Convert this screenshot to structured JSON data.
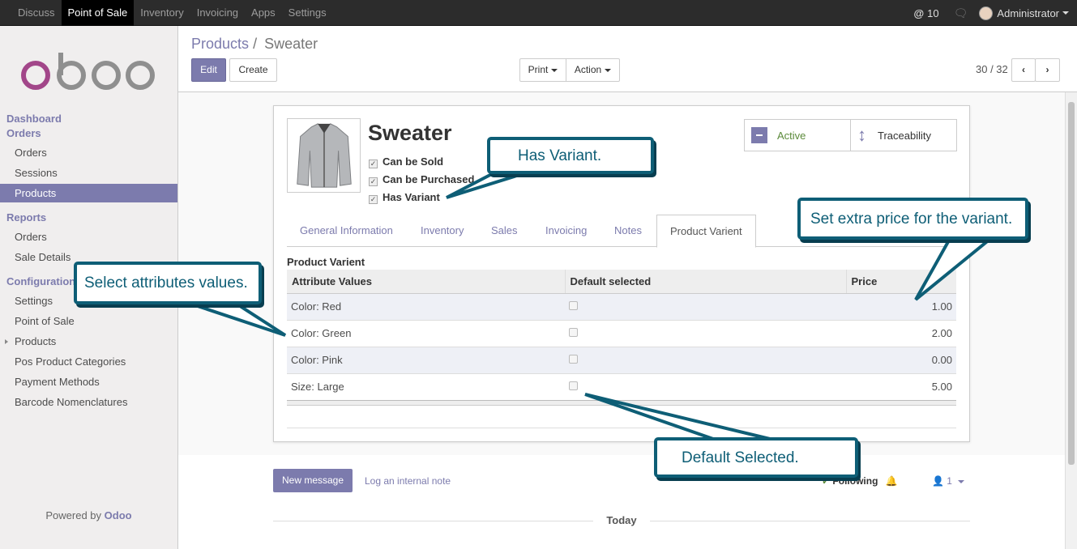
{
  "topbar": {
    "menu": [
      "Discuss",
      "Point of Sale",
      "Inventory",
      "Invoicing",
      "Apps",
      "Settings"
    ],
    "active_menu": "Point of Sale",
    "mentions_symbol": "@",
    "mentions_count": "10",
    "user": "Administrator"
  },
  "sidebar": {
    "dashboard": "Dashboard",
    "orders_section": "Orders",
    "orders_items": [
      "Orders",
      "Sessions",
      "Products"
    ],
    "reports_section": "Reports",
    "reports_items": [
      "Orders",
      "Sale Details"
    ],
    "config_section": "Configuration",
    "config_items": [
      "Settings",
      "Point of Sale",
      "Products",
      "Pos Product Categories",
      "Payment Methods",
      "Barcode Nomenclatures"
    ],
    "powered_prefix": "Powered by",
    "powered_brand": "Odoo"
  },
  "control_panel": {
    "breadcrumb_parent": "Products",
    "breadcrumb_sep": "/",
    "breadcrumb_current": "Sweater",
    "edit": "Edit",
    "create": "Create",
    "print": "Print",
    "action": "Action",
    "pager": "30 / 32"
  },
  "form": {
    "name": "Sweater",
    "can_be_sold": "Can be Sold",
    "can_be_purchased": "Can be Purchased",
    "has_variant": "Has Variant",
    "stat_active": "Active",
    "stat_traceability": "Traceability",
    "tabs": [
      "General Information",
      "Inventory",
      "Sales",
      "Invoicing",
      "Notes",
      "Product Varient"
    ],
    "active_tab": "Product Varient",
    "section_label": "Product Varient",
    "columns": [
      "Attribute Values",
      "Default selected",
      "Price"
    ],
    "rows": [
      {
        "attribute": "Color: Red",
        "price": "1.00"
      },
      {
        "attribute": "Color: Green",
        "price": "2.00"
      },
      {
        "attribute": "Color: Pink",
        "price": "0.00"
      },
      {
        "attribute": "Size: Large",
        "price": "5.00"
      }
    ]
  },
  "chatter": {
    "new_message": "New message",
    "log_note": "Log an internal note",
    "following": "Following",
    "followers": "1",
    "today": "Today"
  },
  "callouts": {
    "has_variant": "Has Variant.",
    "extra_price": "Set extra price for the variant.",
    "select_attr": "Select attributes values.",
    "default_selected": "Default Selected."
  },
  "colors": {
    "brand": "#7c7bad",
    "callout": "#0e5e76",
    "topbar": "#2c2c2c"
  }
}
